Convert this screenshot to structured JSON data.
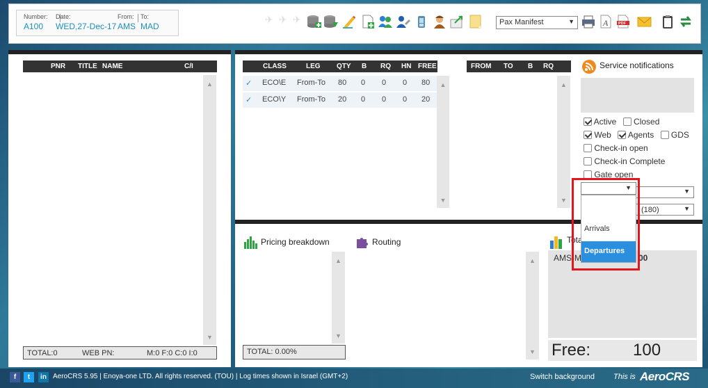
{
  "flight": {
    "number_label": "Number:",
    "number": "A100",
    "date_label": "Date:",
    "date": "WED,27-Dec-17",
    "from_label": "From:",
    "from": "AMS",
    "to_label": "To:",
    "to": "MAD"
  },
  "toolbar": {
    "report_select": "Pax Manifest"
  },
  "pax_table": {
    "headers": [
      "PNR",
      "TITLE",
      "NAME",
      "C/I"
    ],
    "total": "TOTAL:0",
    "web_pn": "WEB PN:",
    "counts": "M:0  F:0  C:0  I:0"
  },
  "class_table": {
    "headers": [
      "CLASS",
      "LEG",
      "QTY",
      "B",
      "RQ",
      "HN",
      "FREE"
    ],
    "rows": [
      {
        "class": "ECO\\E",
        "leg": "From-To",
        "qty": "80",
        "b": "0",
        "rq": "0",
        "hn": "0",
        "free": "80"
      },
      {
        "class": "ECO\\Y",
        "leg": "From-To",
        "qty": "20",
        "b": "0",
        "rq": "0",
        "hn": "0",
        "free": "20"
      }
    ]
  },
  "leg_table": {
    "headers": [
      "FROM",
      "TO",
      "B",
      "RQ"
    ]
  },
  "notifications": {
    "title": "Service notifications",
    "active": "Active",
    "closed": "Closed",
    "web": "Web",
    "agents": "Agents",
    "gds": "GDS",
    "checkin_open": "Check-in open",
    "checkin_complete": "Check-in Complete",
    "gate_open": "Gate open",
    "minutes_select": "(180)",
    "dropdown_options": [
      "Arrivals",
      "Departures"
    ],
    "selected_option": "Departures"
  },
  "pricing": {
    "title": "Pricing breakdown",
    "total": "TOTAL:  0.00%"
  },
  "routing": {
    "title": "Routing"
  },
  "totals": {
    "title": "Tota",
    "route": "AMS-M",
    "value_partial": "00",
    "free_label": "Free:",
    "free_value": "100"
  },
  "status": {
    "copyright": "AeroCRS 5.95  | Enoya-one LTD. All rights reserved. (TOU)  | Log times shown in Israel (GMT+2)",
    "switch_bg": "Switch background",
    "this_is": "This is",
    "brand": "AeroCRS"
  },
  "colors": {
    "accent_blue": "#1c8fc0",
    "header_dark": "#333333",
    "highlight_red": "#e8141c",
    "dropdown_selected": "#2b8fe0"
  }
}
